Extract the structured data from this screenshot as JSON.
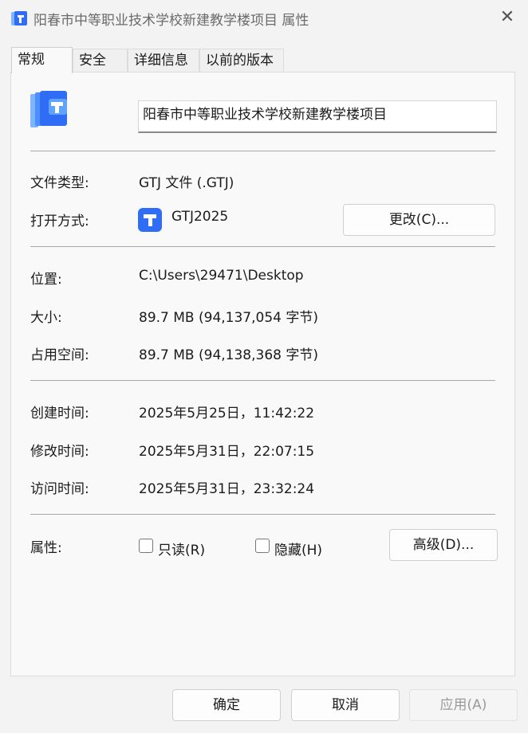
{
  "window": {
    "title": "阳春市中等职业技术学校新建教学楼项目 属性",
    "close_symbol": "✕"
  },
  "tabs": [
    {
      "label": "常规",
      "active": true
    },
    {
      "label": "安全"
    },
    {
      "label": "详细信息"
    },
    {
      "label": "以前的版本"
    }
  ],
  "general": {
    "file_name": "阳春市中等职业技术学校新建教学楼项目",
    "file_type_label": "文件类型:",
    "file_type_value": "GTJ 文件 (.GTJ)",
    "opens_with_label": "打开方式:",
    "opens_with_app": "GTJ2025",
    "change_button": "更改(C)...",
    "location_label": "位置:",
    "location_value": "C:\\Users\\29471\\Desktop",
    "size_label": "大小:",
    "size_value": "89.7 MB (94,137,054 字节)",
    "size_on_disk_label": "占用空间:",
    "size_on_disk_value": "89.7 MB (94,138,368 字节)",
    "created_label": "创建时间:",
    "created_value": "2025年5月25日，11:42:22",
    "modified_label": "修改时间:",
    "modified_value": "2025年5月31日，22:07:15",
    "accessed_label": "访问时间:",
    "accessed_value": "2025年5月31日，23:32:24",
    "attributes_label": "属性:",
    "readonly_label": "只读(R)",
    "readonly_checked": false,
    "hidden_label": "隐藏(H)",
    "hidden_checked": false,
    "advanced_button": "高级(D)..."
  },
  "footer": {
    "ok": "确定",
    "cancel": "取消",
    "apply": "应用(A)",
    "apply_enabled": false
  },
  "colors": {
    "icon_blue": "#2f6df6",
    "icon_light_blue": "#5fa3ff"
  }
}
